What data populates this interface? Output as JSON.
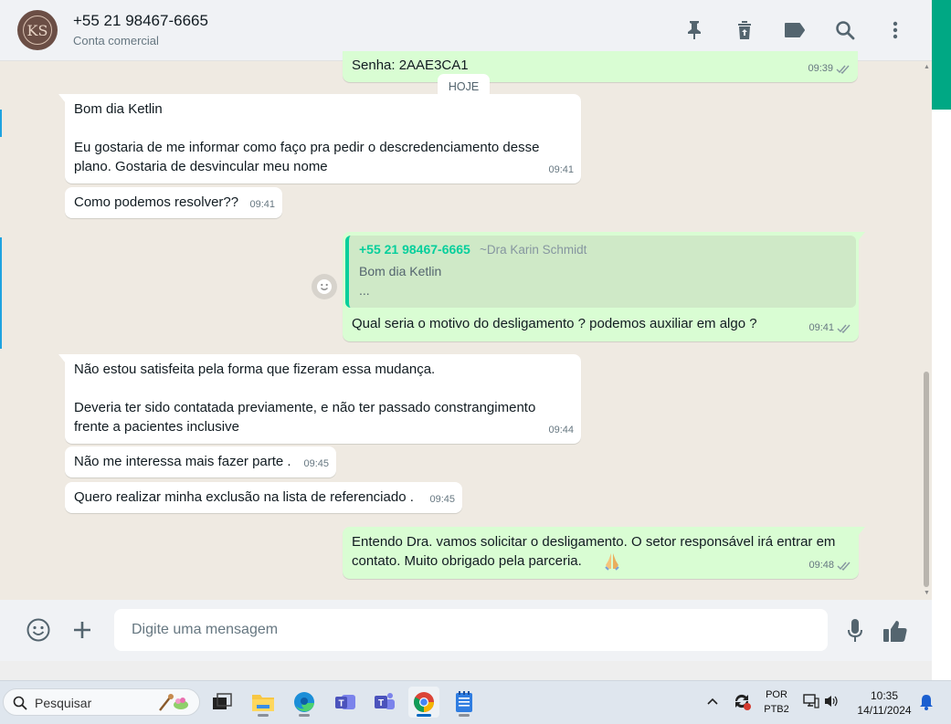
{
  "header": {
    "avatar_text": "KS",
    "contact_name": "+55 21 98467-6665",
    "contact_sub": "Conta comercial",
    "icons": [
      "pin-icon",
      "delete-icon",
      "label-icon",
      "search-icon",
      "menu-icon"
    ]
  },
  "chat": {
    "partial_top": {
      "text": "Senha: 2AAE3CA1",
      "time": "09:39"
    },
    "day_label": "HOJE",
    "messages": [
      {
        "text": "Bom dia Ketlin\n\nEu gostaria de me informar como faço pra pedir o descredenciamento desse\nplano.   Gostaria de desvincular meu nome",
        "time": "09:41"
      },
      {
        "text": "Como podemos resolver??",
        "time": "09:41"
      },
      {
        "text": "Qual seria o motivo do desligamento ? podemos auxiliar em algo ?",
        "time": "09:41"
      },
      {
        "text": "Não estou satisfeita pela forma que fizeram essa mudança.\n\nDeveria ter sido contatada previamente,  e não ter passado constrangimento\nfrente a pacientes inclusive",
        "time": "09:44"
      },
      {
        "text": "Não me interessa mais fazer parte .",
        "time": "09:45"
      },
      {
        "text": "Quero realizar minha exclusão na lista de referenciado .",
        "time": "09:45"
      },
      {
        "text": "Entendo Dra. vamos solicitar o desligamento. O setor responsável irá entrar em\ncontato. Muito obrigado pela parceria.",
        "time": "09:48"
      }
    ],
    "quote": {
      "sender": "+55 21 98467-6665",
      "sender_alias": "~Dra Karin Schmidt",
      "line1": "Bom dia Ketlin",
      "line2": "..."
    }
  },
  "composer": {
    "placeholder": "Digite uma mensagem"
  },
  "colors": {
    "accent": "#00a884",
    "incoming": "#ffffff",
    "outgoing": "#d9fdd3",
    "read_ticks": "#53bdeb"
  },
  "taskbar": {
    "search_label": "Pesquisar",
    "apps": [
      "task-view-icon",
      "file-explorer-icon",
      "edge-icon",
      "teams-icon",
      "teams-classic-icon",
      "chrome-icon",
      "notepad-icon"
    ],
    "lang_line1": "POR",
    "lang_line2": "PTB2",
    "time": "10:35",
    "date": "14/11/2024"
  }
}
